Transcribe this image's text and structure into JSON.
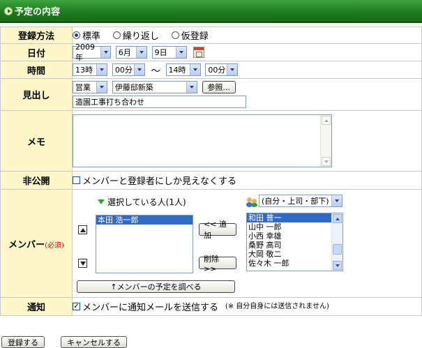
{
  "title": "予定の内容",
  "colors": {
    "titlebar": "#1d7a1d",
    "label_bg": "#fcf6c8",
    "selection": "#316ac5",
    "required": "#e00000"
  },
  "rows": {
    "method": {
      "label": "登録方法",
      "options": [
        "標準",
        "繰り返し",
        "仮登録"
      ],
      "selected": "標準"
    },
    "date": {
      "label": "日付",
      "year": "2009年",
      "month": "6月",
      "day": "9日",
      "calendar_icon": "calendar-icon"
    },
    "time": {
      "label": "時間",
      "start_hour": "13時",
      "start_min": "00分",
      "separator": "〜",
      "end_hour": "14時",
      "end_min": "00分"
    },
    "heading": {
      "label": "見出し",
      "category": "営業",
      "facility": "伊藤邸新築",
      "ref_button": "参照...",
      "text": "造園工事打ち合わせ"
    },
    "memo": {
      "label": "メモ",
      "value": ""
    },
    "private": {
      "label": "非公開",
      "checkbox_label": "メンバーと登録者にしか見えなくする",
      "checked": false
    },
    "members": {
      "label": "メンバー",
      "required_mark": "(必須)",
      "selected_header": "選択している人(1人)",
      "selected": [
        "本田 浩一郎"
      ],
      "add_button": "<< 追加",
      "remove_button": "削除 >>",
      "group_select": "(自分・上司・部下)",
      "candidates": [
        "和田 普一",
        "山中 一郎",
        "小西 幸雄",
        "桑野 高司",
        "大岡 敬二",
        "佐々木 一郎"
      ],
      "candidate_selected": "和田 普一",
      "check_schedule_button": "↑メンバーの予定を調べる"
    },
    "notify": {
      "label": "通知",
      "checkbox_label": "メンバーに通知メールを送信する",
      "checked": true,
      "note": "(※ 自分自身には送信されません)"
    }
  },
  "buttons": {
    "register": "登録する",
    "cancel": "キャンセルする"
  }
}
